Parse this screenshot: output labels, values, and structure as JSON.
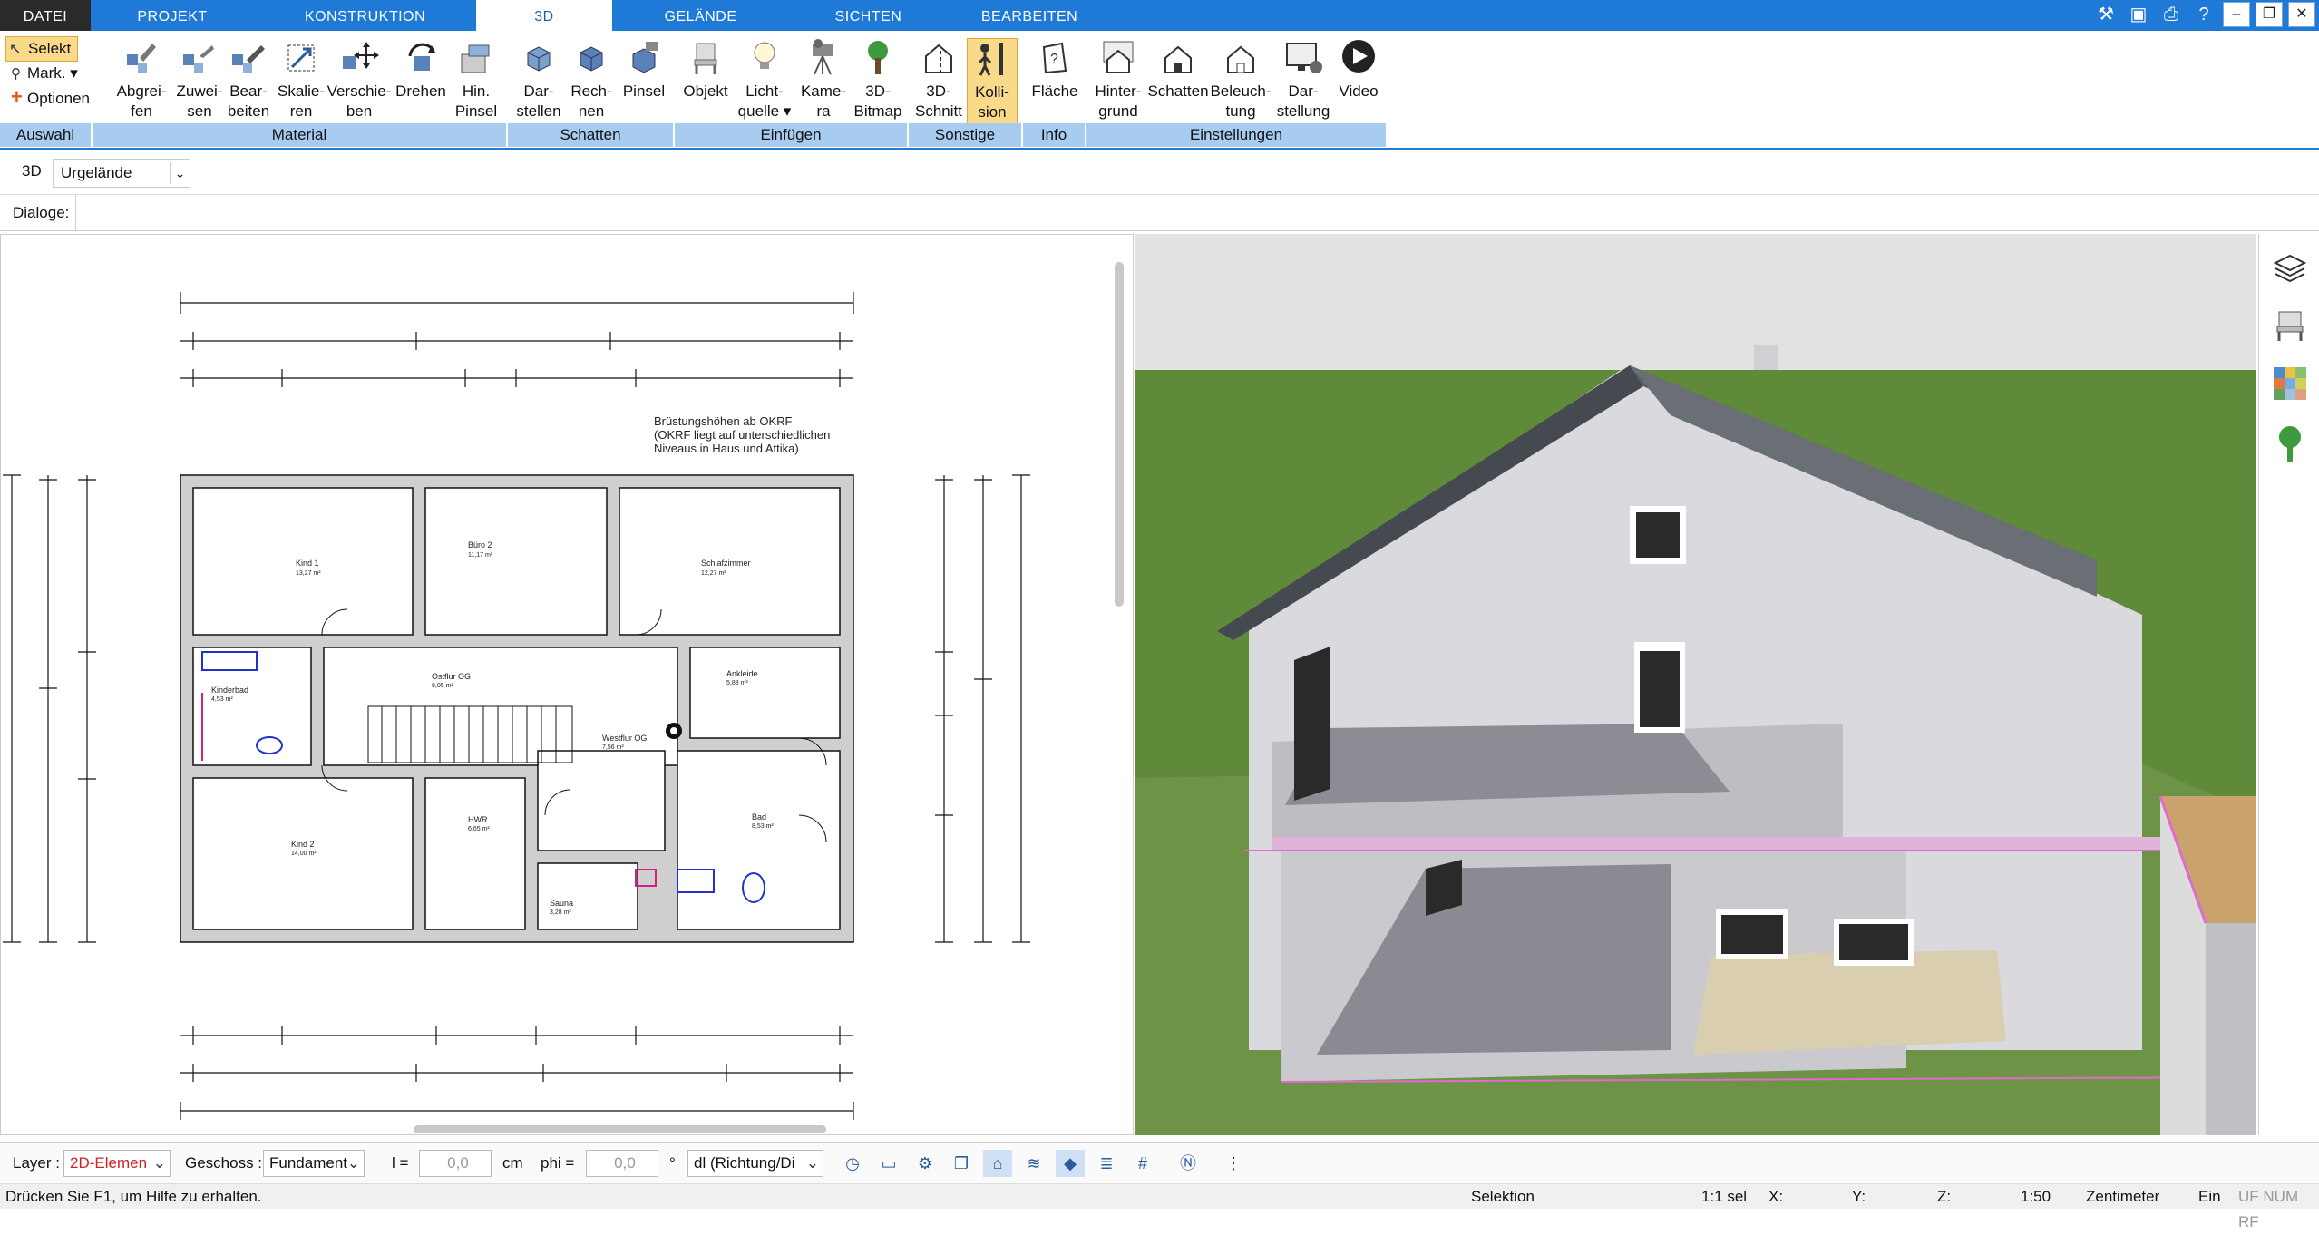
{
  "menu": {
    "tabs": [
      "DATEI",
      "PROJEKT",
      "KONSTRUKTION",
      "3D",
      "GELÄNDE",
      "SICHTEN",
      "BEARBEITEN"
    ],
    "active": "3D"
  },
  "ribbon": {
    "auswahl": {
      "selekt": "Selekt",
      "mark": "Mark.",
      "optionen": "Optionen",
      "group": "Auswahl"
    },
    "material": {
      "group": "Material",
      "buttons": [
        "Abgrei-\nfen",
        "Zuwei-\nsen",
        "Bear-\nbeiten",
        "Skalie-\nren",
        "Verschie-\nben",
        "Drehen",
        "Hin.\nPinsel"
      ]
    },
    "schatten": {
      "group": "Schatten",
      "buttons": [
        "Dar-\nstellen",
        "Rech-\nnen",
        "Pinsel"
      ]
    },
    "einfuegen": {
      "group": "Einfügen",
      "buttons": [
        "Objekt",
        "Licht-\nquelle",
        "Kame-\nra",
        "3D-\nBitmap"
      ]
    },
    "sonstige": {
      "group": "Sonstige",
      "buttons": [
        "3D-\nSchnitt",
        "Kolli-\nsion"
      ]
    },
    "info": {
      "group": "Info",
      "buttons": [
        "Fläche"
      ]
    },
    "einstellungen": {
      "group": "Einstellungen",
      "buttons": [
        "Hinter-\ngrund",
        "Schatten",
        "Beleuch-\ntung",
        "Dar-\nstellung",
        "Video"
      ]
    }
  },
  "toolbar": {
    "mode": "3D",
    "terrain": "Urgelände",
    "dialoge": "Dialoge:"
  },
  "plan": {
    "note": [
      "Brüstungshöhen ab OKRF",
      "(OKRF liegt auf unterschiedlichen",
      "Niveaus in Haus und Attika)"
    ],
    "rooms": [
      {
        "name": "Kind 1",
        "area": "13,27 m²"
      },
      {
        "name": "Büro 2",
        "area": "11,17 m²"
      },
      {
        "name": "Schlafzimmer",
        "area": "12,27 m²"
      },
      {
        "name": "Kinderbad",
        "area": "4,53 m²"
      },
      {
        "name": "Ostflur OG",
        "area": "8,05 m²"
      },
      {
        "name": "Ankleide",
        "area": "5,88 m²"
      },
      {
        "name": "Westflur OG",
        "area": "7,56 m²"
      },
      {
        "name": "HWR",
        "area": "6,65 m²"
      },
      {
        "name": "Kind 2",
        "area": "14,00 m²"
      },
      {
        "name": "Bad",
        "area": "8,53 m²"
      },
      {
        "name": "Sauna",
        "area": "3,28 m²"
      }
    ]
  },
  "bottom": {
    "layer_label": "Layer :",
    "layer_value": "2D-Elemen",
    "geschoss_label": "Geschoss :",
    "geschoss_value": "Fundament",
    "l_label": "l =",
    "l_value": "0,0",
    "l_unit": "cm",
    "phi_label": "phi =",
    "phi_value": "0,0",
    "phi_unit": "°",
    "dl_value": "dl (Richtung/Di"
  },
  "status": {
    "help": "Drücken Sie F1, um Hilfe zu erhalten.",
    "mode": "Selektion",
    "sel": "1:1 sel",
    "x": "X:",
    "y": "Y:",
    "z": "Z:",
    "scale": "1:50",
    "unit": "Zentimeter",
    "ein": "Ein",
    "flags": "UF NUM RF"
  },
  "colors": {
    "accent": "#1e7ad6",
    "groupbar": "#a8ccf0",
    "grass": "#5f8a3a",
    "roof": "#5a5e63",
    "highlight": "#f9d98a"
  }
}
